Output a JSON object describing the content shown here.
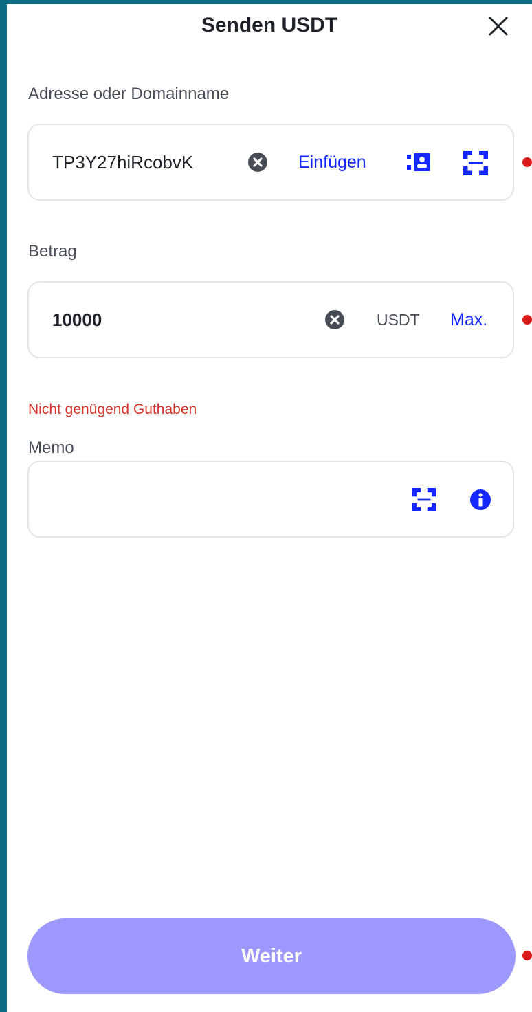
{
  "header": {
    "title": "Senden USDT"
  },
  "address": {
    "label": "Adresse oder Domainname",
    "value": "TP3Y27hiRcobvK",
    "paste_label": "Einfügen"
  },
  "amount": {
    "label": "Betrag",
    "value": "10000",
    "unit": "USDT",
    "max_label": "Max.",
    "error": "Nicht genügend Guthaben"
  },
  "memo": {
    "label": "Memo",
    "value": ""
  },
  "footer": {
    "submit_label": "Weiter"
  },
  "icons": {
    "close": "close-icon",
    "clear": "clear-icon",
    "address_book": "address-book-icon",
    "scan": "scan-icon",
    "info": "info-icon"
  },
  "colors": {
    "accent": "#1428ff",
    "error": "#d4342c",
    "submit_disabled": "#9d98fe",
    "frame": "#0b6b82"
  }
}
